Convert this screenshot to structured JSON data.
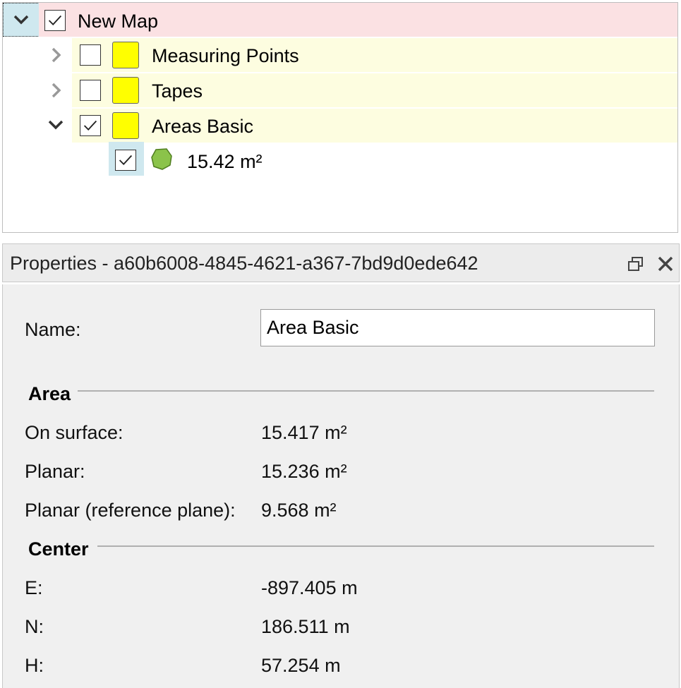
{
  "tree": {
    "root": {
      "label": "New Map",
      "checked": true,
      "expanded": true
    },
    "layers": [
      {
        "label": "Measuring Points",
        "checked": false,
        "expanded": false,
        "color": "#ffff00"
      },
      {
        "label": "Tapes",
        "checked": false,
        "expanded": false,
        "color": "#ffff00"
      },
      {
        "label": "Areas Basic",
        "checked": true,
        "expanded": true,
        "color": "#ffff00"
      }
    ],
    "item": {
      "label": "15.42 m²",
      "checked": true,
      "icon": "green-polygon-icon",
      "selected": true
    }
  },
  "properties": {
    "title": "Properties - a60b6008-4845-4621-a367-7bd9d0ede642",
    "name_label": "Name:",
    "name_value": "Area Basic",
    "area": {
      "title": "Area",
      "rows": [
        {
          "label": "On surface:",
          "value": "15.417 m²"
        },
        {
          "label": "Planar:",
          "value": "15.236 m²"
        },
        {
          "label": "Planar (reference plane):",
          "value": "9.568 m²"
        }
      ]
    },
    "center": {
      "title": "Center",
      "rows": [
        {
          "label": "E:",
          "value": "-897.405 m"
        },
        {
          "label": "N:",
          "value": "186.511 m"
        },
        {
          "label": "H:",
          "value": "57.254 m"
        }
      ]
    }
  },
  "colors": {
    "map_row": "#fbe1e3",
    "layer_row": "#fdfde0",
    "selected_row": "#cfe8ef",
    "layer_swatch": "#ffff00",
    "polygon": "#8bc34a"
  }
}
